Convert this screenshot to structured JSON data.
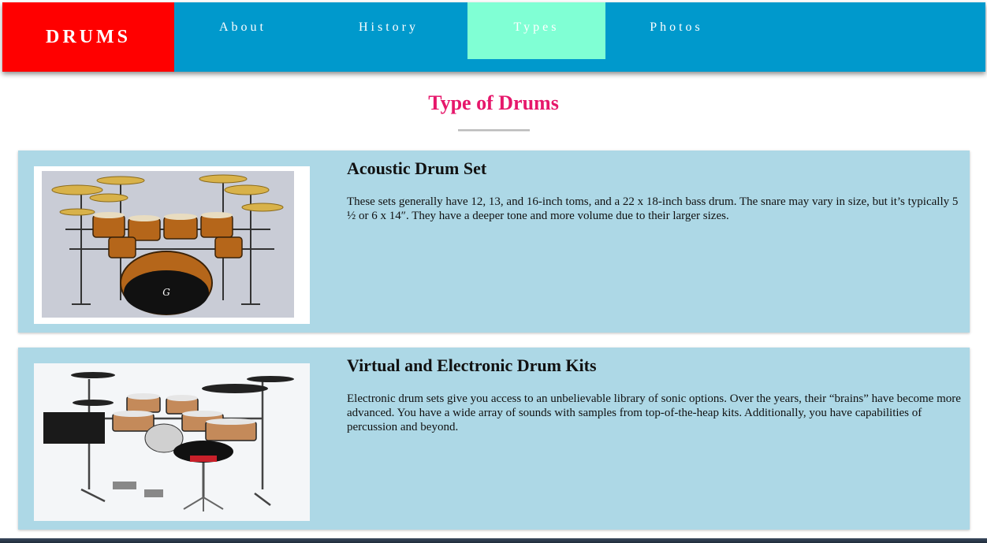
{
  "brand": "DRUMS",
  "nav": {
    "about": "About",
    "history": "History",
    "types": "Types",
    "photos": "Photos",
    "active": "Types"
  },
  "page": {
    "title": "Type of Drums"
  },
  "cards": [
    {
      "heading": "Acoustic Drum Set",
      "text": "These sets generally have 12, 13, and 16-inch toms, and a 22 x 18-inch bass drum. The snare may vary in size, but it’s typically 5 ½ or 6 x 14″. They have a deeper tone and more volume due to their larger sizes.",
      "image": "acoustic-drum-kit-photo"
    },
    {
      "heading": "Virtual and Electronic Drum Kits",
      "text": "Electronic drum sets give you access to an unbelievable library of sonic options. Over the years, their “brains” have become more advanced. You have a wide array of sounds with samples from top-of-the-heap kits. Additionally, you have capabilities of percussion and beyond.",
      "image": "electronic-drum-kit-photo"
    }
  ],
  "colors": {
    "navbar": "#0099cc",
    "brand_bg": "#ff0000",
    "active_tab": "#80ffd4",
    "title": "#e6176b",
    "card_bg": "#add8e6"
  }
}
